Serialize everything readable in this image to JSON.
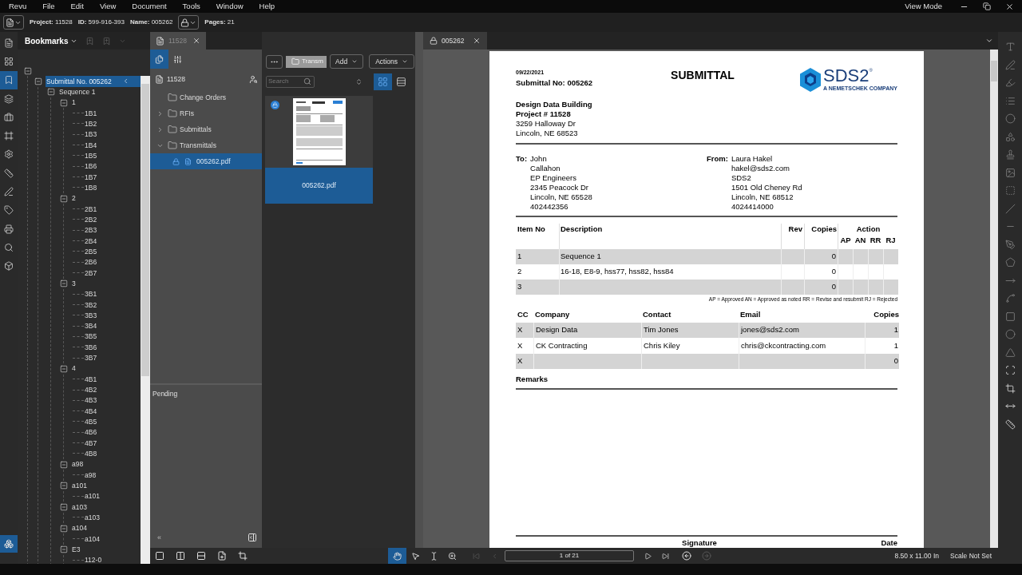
{
  "menu": {
    "items": [
      "Revu",
      "File",
      "Edit",
      "View",
      "Document",
      "Tools",
      "Window",
      "Help"
    ],
    "view_mode": "View Mode"
  },
  "toolbar": {
    "fields": [
      {
        "label": "Project:",
        "value": "11528"
      },
      {
        "label": "ID:",
        "value": "599-916-393"
      },
      {
        "label": "Name:",
        "value": "005262"
      }
    ],
    "pages": {
      "label": "Pages:",
      "value": "21"
    }
  },
  "rail": [
    {
      "selected": false
    },
    {
      "selected": false
    },
    {
      "selected": true
    },
    {
      "selected": false
    },
    {
      "selected": false
    },
    {
      "selected": false
    },
    {
      "selected": false
    },
    {
      "selected": false
    },
    {
      "selected": false
    },
    {
      "selected": false
    },
    {
      "selected": false
    },
    {
      "selected": false
    },
    {
      "selected": false
    }
  ],
  "bookmarks": {
    "title": "Bookmarks",
    "root_expanded": true,
    "tree": [
      {
        "label": "Submittal No. 005262",
        "selected": true,
        "expanded": true,
        "children": [
          {
            "label": "Sequence 1",
            "selected": false,
            "expanded": true,
            "children": [
              {
                "label": "1",
                "selected": false,
                "expanded": true,
                "children": [
                  {
                    "label": "1B1",
                    "selected": false
                  },
                  {
                    "label": "1B2",
                    "selected": false
                  },
                  {
                    "label": "1B3",
                    "selected": false
                  },
                  {
                    "label": "1B4",
                    "selected": false
                  },
                  {
                    "label": "1B5",
                    "selected": false
                  },
                  {
                    "label": "1B6",
                    "selected": false
                  },
                  {
                    "label": "1B7",
                    "selected": false
                  },
                  {
                    "label": "1B8",
                    "selected": false
                  }
                ]
              },
              {
                "label": "2",
                "selected": false,
                "expanded": true,
                "children": [
                  {
                    "label": "2B1",
                    "selected": false
                  },
                  {
                    "label": "2B2",
                    "selected": false
                  },
                  {
                    "label": "2B3",
                    "selected": false
                  },
                  {
                    "label": "2B4",
                    "selected": false
                  },
                  {
                    "label": "2B5",
                    "selected": false
                  },
                  {
                    "label": "2B6",
                    "selected": false
                  },
                  {
                    "label": "2B7",
                    "selected": false
                  }
                ]
              },
              {
                "label": "3",
                "selected": false,
                "expanded": true,
                "children": [
                  {
                    "label": "3B1",
                    "selected": false
                  },
                  {
                    "label": "3B2",
                    "selected": false
                  },
                  {
                    "label": "3B3",
                    "selected": false
                  },
                  {
                    "label": "3B4",
                    "selected": false
                  },
                  {
                    "label": "3B5",
                    "selected": false
                  },
                  {
                    "label": "3B6",
                    "selected": false
                  },
                  {
                    "label": "3B7",
                    "selected": false
                  }
                ]
              },
              {
                "label": "4",
                "selected": false,
                "expanded": true,
                "children": [
                  {
                    "label": "4B1",
                    "selected": false
                  },
                  {
                    "label": "4B2",
                    "selected": false
                  },
                  {
                    "label": "4B3",
                    "selected": false
                  },
                  {
                    "label": "4B4",
                    "selected": false
                  },
                  {
                    "label": "4B5",
                    "selected": false
                  },
                  {
                    "label": "4B6",
                    "selected": false
                  },
                  {
                    "label": "4B7",
                    "selected": false
                  },
                  {
                    "label": "4B8",
                    "selected": false
                  }
                ]
              },
              {
                "label": "a98",
                "selected": false,
                "expanded": true,
                "children": [
                  {
                    "label": "a98",
                    "selected": false
                  }
                ]
              },
              {
                "label": "a101",
                "selected": false,
                "expanded": true,
                "children": [
                  {
                    "label": "a101",
                    "selected": false
                  }
                ]
              },
              {
                "label": "a103",
                "selected": false,
                "expanded": true,
                "children": [
                  {
                    "label": "a103",
                    "selected": false
                  }
                ]
              },
              {
                "label": "a104",
                "selected": false,
                "expanded": true,
                "children": [
                  {
                    "label": "a104",
                    "selected": false
                  }
                ]
              },
              {
                "label": "E3",
                "selected": false,
                "expanded": true,
                "children": [
                  {
                    "label": "112-0",
                    "selected": false
                  }
                ]
              }
            ]
          }
        ]
      }
    ]
  },
  "studio": {
    "tab": "11528",
    "tools": [
      {
        "selected": true
      },
      {
        "selected": false
      }
    ],
    "project": "11528",
    "tree": [
      {
        "label": "Change Orders",
        "kind": "leaf",
        "selected": false
      },
      {
        "label": "RFIs",
        "kind": "folder",
        "selected": false,
        "expanded": false
      },
      {
        "label": "Submittals",
        "kind": "folder",
        "selected": false,
        "expanded": false
      },
      {
        "label": "Transmittals",
        "kind": "folder",
        "selected": false,
        "expanded": true,
        "children": [
          {
            "label": "005262.pdf",
            "kind": "file",
            "selected": true,
            "locked": true
          }
        ]
      }
    ],
    "pending": "Pending",
    "collapse": "«"
  },
  "files": {
    "breadcrumb": "Transm",
    "add": "Add",
    "actions": "Actions",
    "search": {
      "placeholder": "Search"
    },
    "views": [
      {
        "selected": true
      },
      {
        "selected": false
      }
    ],
    "items": [
      {
        "name": "005262.pdf",
        "selected": true,
        "locked": true
      }
    ]
  },
  "document_tab": {
    "title": "005262",
    "locked": true
  },
  "page": {
    "date": "09/22/2021",
    "number": "Submittal No: 005262",
    "title": "SUBMITTAL",
    "logo": {
      "name": "SDS2",
      "mark": "®",
      "tagline": "A NEMETSCHEK COMPANY"
    },
    "project": {
      "name": "Design Data Building",
      "number": "Project # 11528",
      "address": [
        "3259 Halloway Dr",
        "Lincoln, NE 68523"
      ]
    },
    "to": {
      "label": "To:",
      "lines": [
        "John",
        "Callahon",
        "EP Engineers",
        "2345 Peacock Dr",
        "Lincoln, NE 65528",
        "402442356"
      ]
    },
    "from": {
      "label": "From:",
      "lines": [
        "Laura Hakel",
        "hakel@sds2.com",
        "SDS2",
        "1501 Old Cheney Rd",
        "Lincoln, NE 68512",
        "4024414000"
      ]
    },
    "items": {
      "columns": [
        "Item No",
        "Description",
        "Rev",
        "Copies",
        "Action"
      ],
      "action_codes": [
        "AP",
        "AN",
        "RR",
        "RJ"
      ],
      "rows": [
        {
          "item": "1",
          "description": "Sequence 1",
          "copies": "0"
        },
        {
          "item": "2",
          "description": "16-18, E8-9, hss77, hss82, hss84",
          "copies": "0"
        },
        {
          "item": "3",
          "copies": "0"
        }
      ]
    },
    "legend": "AP = Approved AN = Approved as noted RR = Revise and resubmit RJ = Rejected",
    "cc": {
      "columns": [
        "CC",
        "Company",
        "Contact",
        "Email",
        "Copies"
      ],
      "rows": [
        {
          "cc": "X",
          "company": "Design Data",
          "contact": "Tim Jones",
          "email": "jones@sds2.com",
          "copies": "1"
        },
        {
          "cc": "X",
          "company": "CK Contracting",
          "contact": "Chris Kiley",
          "email": "chris@ckcontracting.com",
          "copies": "1"
        },
        {
          "cc": "X",
          "copies": "0"
        }
      ]
    },
    "remarks": "Remarks",
    "signature": "Signature",
    "date_label": "Date"
  },
  "status": {
    "tools": [
      {
        "selected": true
      },
      {
        "selected": false
      },
      {
        "selected": false
      },
      {
        "selected": false
      }
    ],
    "nav": [
      {
        "disabled": true
      },
      {
        "disabled": true
      },
      {
        "disabled": false
      },
      {
        "disabled": false
      },
      {
        "disabled": false
      },
      {
        "disabled": true
      }
    ],
    "page": "1 of 21",
    "size": "8.50 x 11.00 In",
    "scale": "Scale Not Set"
  }
}
